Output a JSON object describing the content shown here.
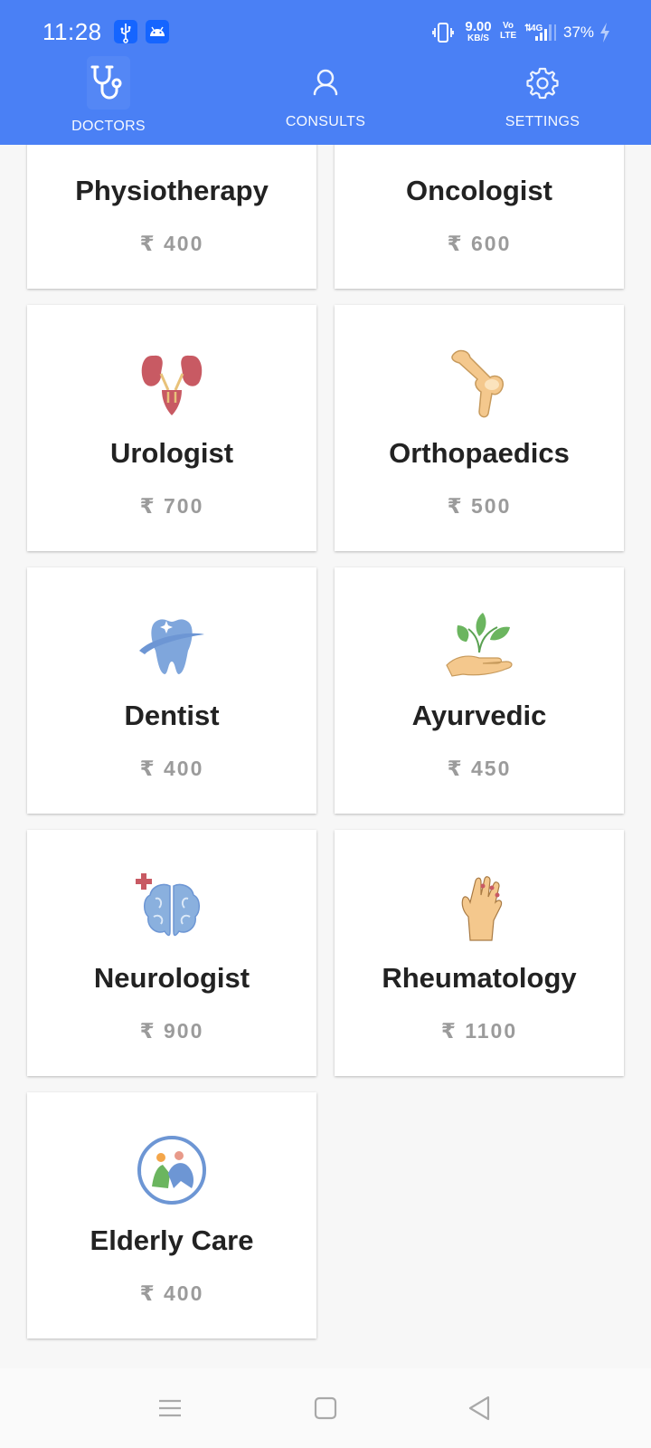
{
  "status_bar": {
    "time": "11:28",
    "net_speed_value": "9.00",
    "net_speed_unit": "KB/S",
    "volte_top": "Vo",
    "volte_bottom": "LTE",
    "network": "4G",
    "battery": "37%",
    "icons": [
      "usb-icon",
      "android-icon",
      "vibrate-icon",
      "signal-icon",
      "charging-icon"
    ]
  },
  "tabs": [
    {
      "label": "DOCTORS",
      "icon": "stethoscope-icon",
      "active": true
    },
    {
      "label": "CONSULTS",
      "icon": "person-icon",
      "active": false
    },
    {
      "label": "SETTINGS",
      "icon": "gear-icon",
      "active": false
    }
  ],
  "specialities": [
    {
      "name": "Physiotherapy",
      "price": "₹ 400"
    },
    {
      "name": "Oncologist",
      "price": "₹ 600"
    },
    {
      "name": "Urologist",
      "price": "₹ 700",
      "icon": "kidney-icon"
    },
    {
      "name": "Orthopaedics",
      "price": "₹ 500",
      "icon": "knee-joint-icon"
    },
    {
      "name": "Dentist",
      "price": "₹ 400",
      "icon": "tooth-icon"
    },
    {
      "name": "Ayurvedic",
      "price": "₹ 450",
      "icon": "herb-hand-icon"
    },
    {
      "name": "Neurologist",
      "price": "₹ 900",
      "icon": "brain-icon"
    },
    {
      "name": "Rheumatology",
      "price": "₹ 1100",
      "icon": "hand-joint-icon"
    },
    {
      "name": "Elderly Care",
      "price": "₹ 400",
      "icon": "elderly-care-icon"
    }
  ],
  "colors": {
    "header": "#4a80f5",
    "price_text": "#9b9b9b",
    "title_text": "#222222",
    "background": "#f7f7f7"
  },
  "nav_bar": {
    "icons": [
      "menu-icon",
      "home-square-icon",
      "back-triangle-icon"
    ]
  }
}
